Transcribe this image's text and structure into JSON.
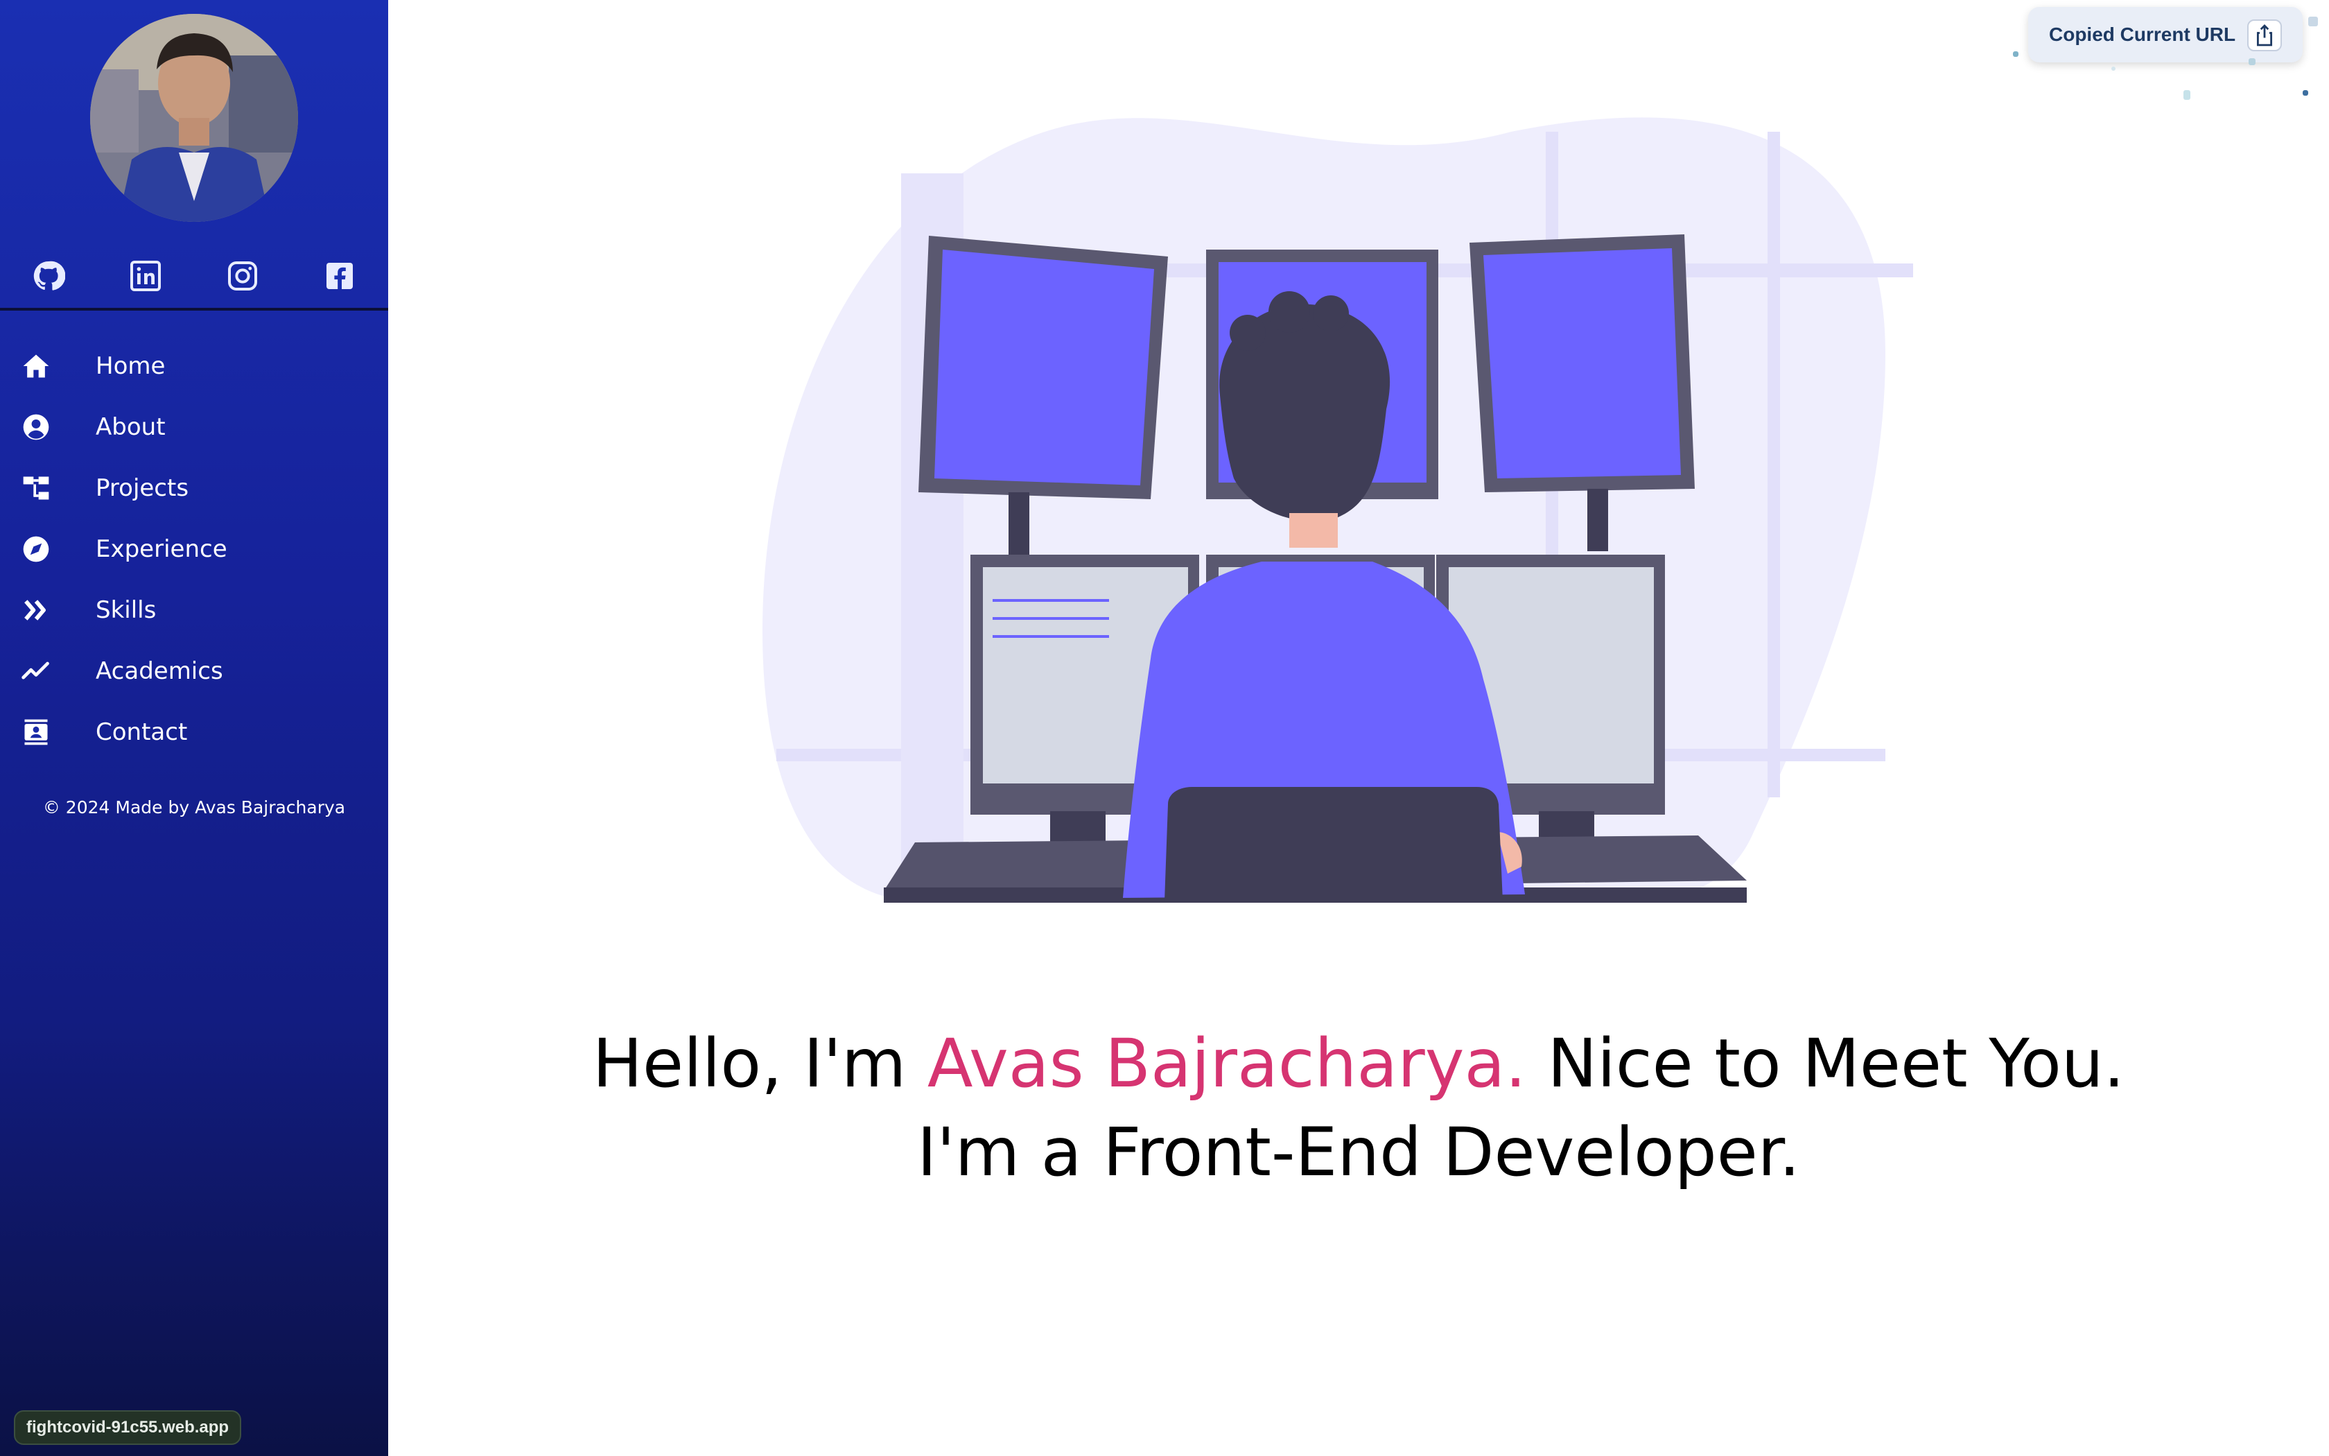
{
  "sidebar": {
    "avatar_alt": "Avas Bajracharya",
    "social": [
      {
        "name": "github-icon"
      },
      {
        "name": "linkedin-icon"
      },
      {
        "name": "instagram-icon"
      },
      {
        "name": "facebook-icon"
      }
    ],
    "nav": [
      {
        "label": "Home",
        "icon": "home-icon"
      },
      {
        "label": "About",
        "icon": "user-circle-icon"
      },
      {
        "label": "Projects",
        "icon": "sitemap-icon"
      },
      {
        "label": "Experience",
        "icon": "compass-icon"
      },
      {
        "label": "Skills",
        "icon": "double-chevron-right-icon"
      },
      {
        "label": "Academics",
        "icon": "trend-line-icon"
      },
      {
        "label": "Contact",
        "icon": "contact-book-icon"
      }
    ],
    "copyright": "© 2024 Made by Avas Bajracharya"
  },
  "hero": {
    "line1_prefix": "Hello, I'm ",
    "line1_name": "Avas Bajracharya.",
    "line1_suffix": " Nice to Meet You.",
    "line2": "I'm a Front-End Developer."
  },
  "toast": {
    "text": "Copied Current URL"
  },
  "status_bar": {
    "url": "fightcovid-91c55.web.app"
  },
  "colors": {
    "sidebar_top": "#1a2fb2",
    "sidebar_bottom": "#0b1145",
    "accent_name": "#d63471",
    "illustration_purple": "#6c63ff"
  }
}
